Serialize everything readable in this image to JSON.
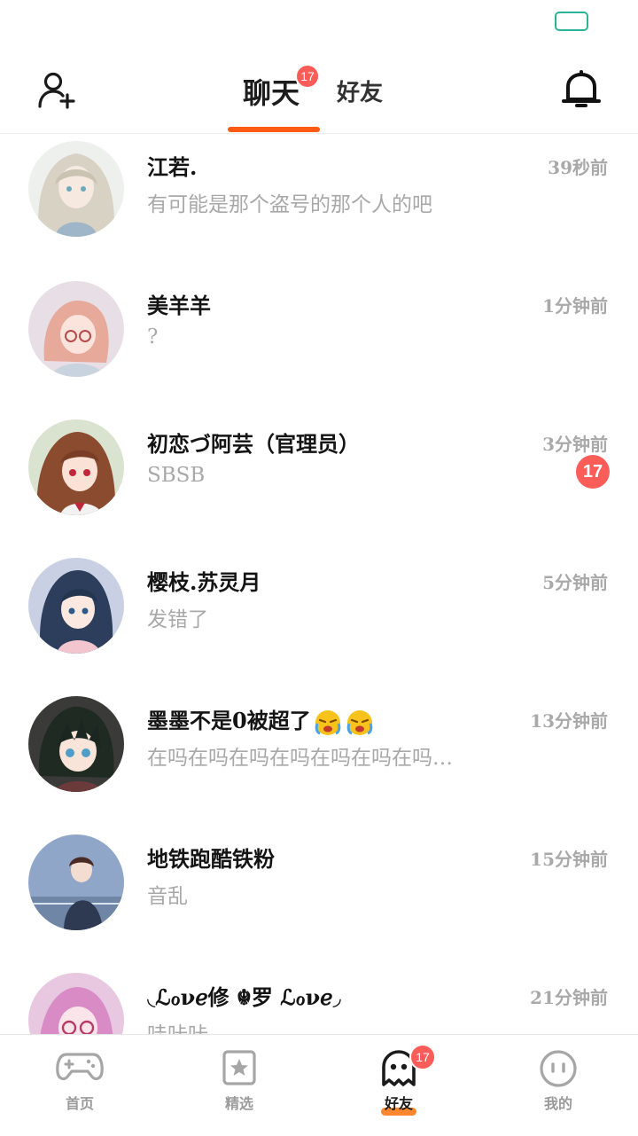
{
  "header": {
    "tabs": [
      {
        "label": "聊天",
        "badge": "17"
      },
      {
        "label": "好友"
      }
    ],
    "accent_color": "#ff5a13"
  },
  "conversations": [
    {
      "name": "江若.",
      "message": "有可能是那个盗号的那个人的吧",
      "time": "39秒前"
    },
    {
      "name": "美羊羊",
      "message": "?",
      "time": "1分钟前"
    },
    {
      "name": "初恋づ阿芸（官理员）",
      "message": "SBSB",
      "time": "3分钟前",
      "unread": "17"
    },
    {
      "name": "樱枝.苏灵月",
      "message": "发错了",
      "time": "5分钟前"
    },
    {
      "name": "墨墨不是0被超了",
      "message": "在吗在吗在吗在吗在吗在吗在吗…",
      "time": "13分钟前"
    },
    {
      "name": "地铁跑酷铁粉",
      "message": "音乱",
      "time": "15分钟前"
    },
    {
      "name": "◟ℒℴνℯ修 ☬罗 ℒℴνℯ◞",
      "message": "哇咔咔",
      "time": "21分钟前"
    }
  ],
  "tabbar": {
    "items": [
      {
        "label": "首页",
        "icon": "gamepad-icon"
      },
      {
        "label": "精选",
        "icon": "star-bookmark-icon"
      },
      {
        "label": "好友",
        "icon": "ghost-icon",
        "badge": "17"
      },
      {
        "label": "我的",
        "icon": "face-icon"
      }
    ]
  },
  "colors": {
    "badge": "#fc5d58",
    "battery": "#2bb49a"
  }
}
